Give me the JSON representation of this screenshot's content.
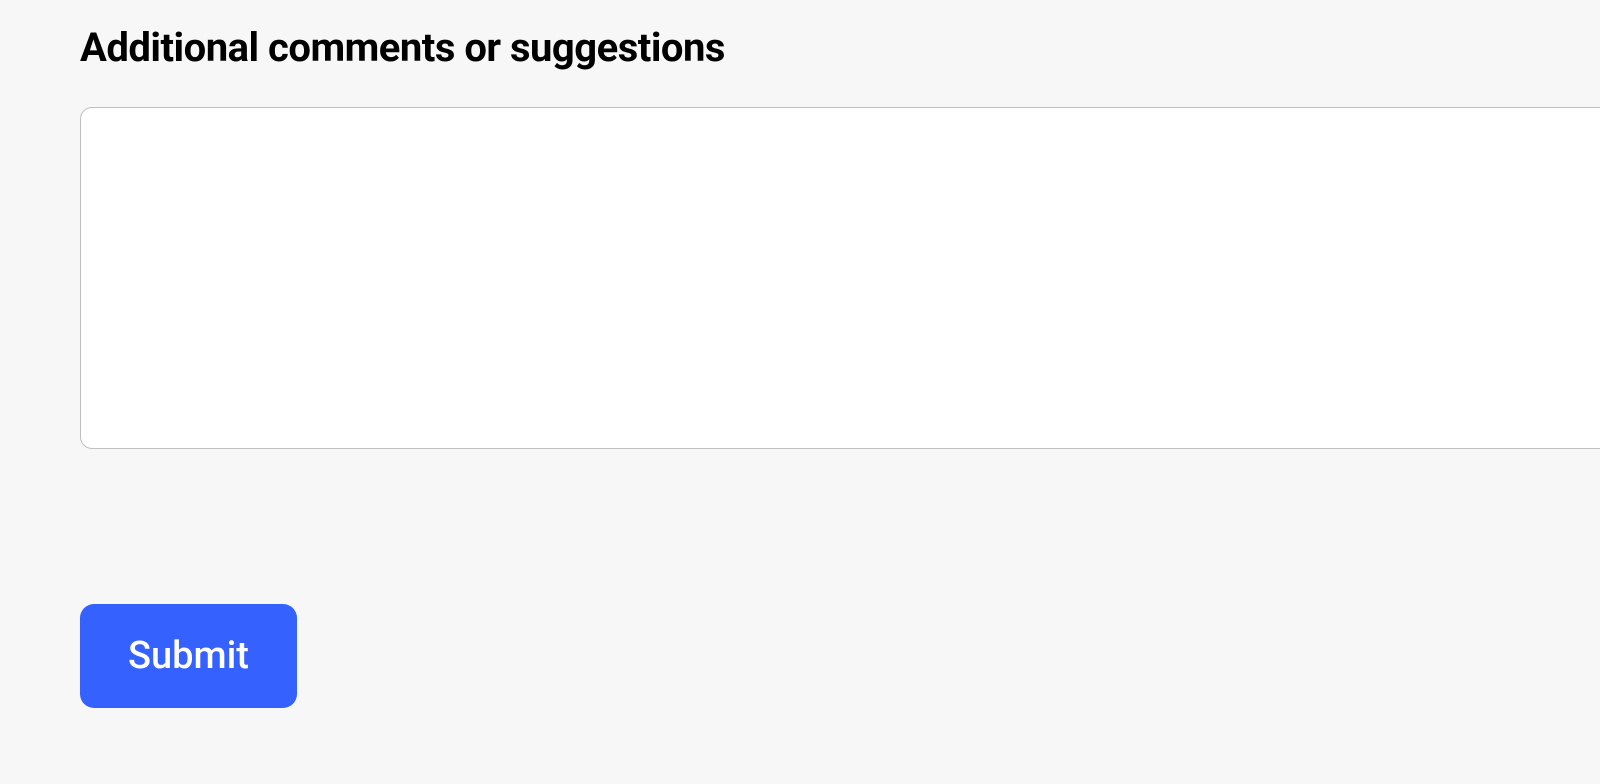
{
  "form": {
    "comments_label": "Additional comments or suggestions",
    "comments_value": "",
    "submit_label": "Submit"
  },
  "colors": {
    "button_bg": "#3461ff",
    "page_bg": "#f7f7f7",
    "textarea_border": "#bfbfbf"
  }
}
